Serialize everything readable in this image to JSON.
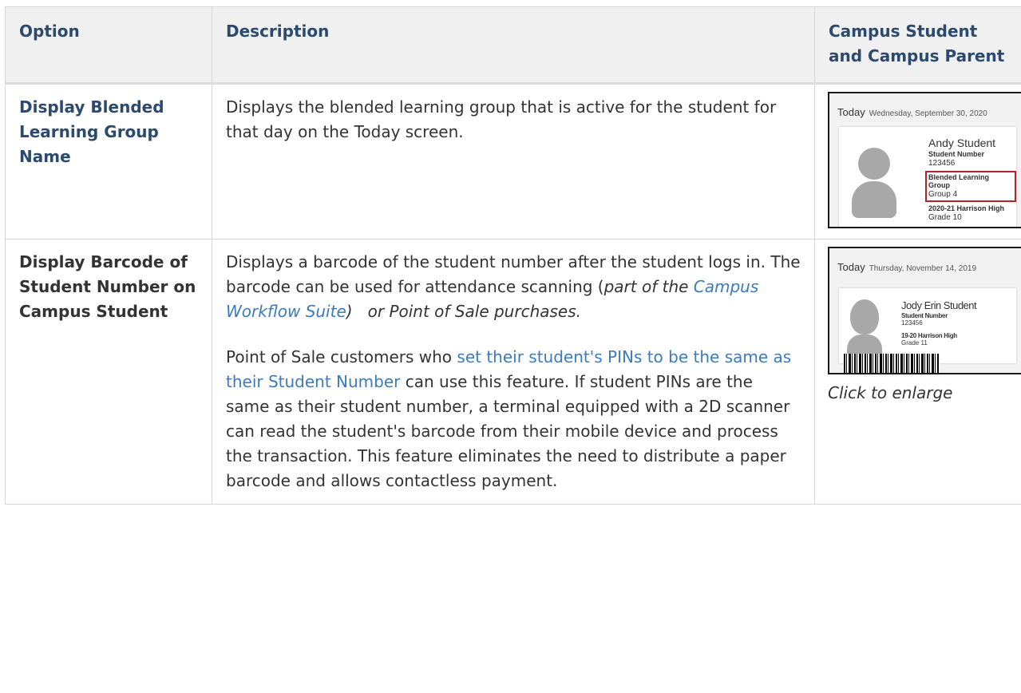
{
  "headers": {
    "option": "Option",
    "description": "Description",
    "campus": "Campus Student and Campus Parent"
  },
  "row1": {
    "option": "Display Blended Learning Group Name",
    "description": "Displays the blended learning group that is active for the student for that day on the Today screen.",
    "shot": {
      "today": "Today",
      "date": "Wednesday, September 30, 2020",
      "name": "Andy Student",
      "student_number_label": "Student Number",
      "student_number": "123456",
      "group_label": "Blended Learning Group",
      "group_value": "Group 4",
      "school": "2020-21 Harrison High",
      "grade": "Grade 10"
    }
  },
  "row2": {
    "option": "Display Barcode of Student Number on Campus Student",
    "p1_a": "Displays a barcode of the student number after the student logs in. The barcode can be used for attendance scanning (",
    "p1_italic": "part of the ",
    "p1_link": "Campus Workflow Suite",
    "p1_b": ")   or Point of Sale purchases.",
    "p2_a": "Point of Sale customers who ",
    "p2_link": "set their student's PINs to be the same as their Student Number",
    "p2_b": " can use this feature. If student PINs are the same as their student number, a terminal equipped with a 2D scanner can read the student's barcode from their mobile device and process the transaction. This feature eliminates the need to distribute a paper barcode and allows contactless payment.",
    "shot": {
      "today": "Today",
      "date": "Thursday, November 14, 2019",
      "name": "Jody Erin Student",
      "student_number_label": "Student Number",
      "student_number": "123456",
      "school": "19-20 Harrison High",
      "grade": "Grade 11"
    },
    "caption": "Click to enlarge"
  }
}
